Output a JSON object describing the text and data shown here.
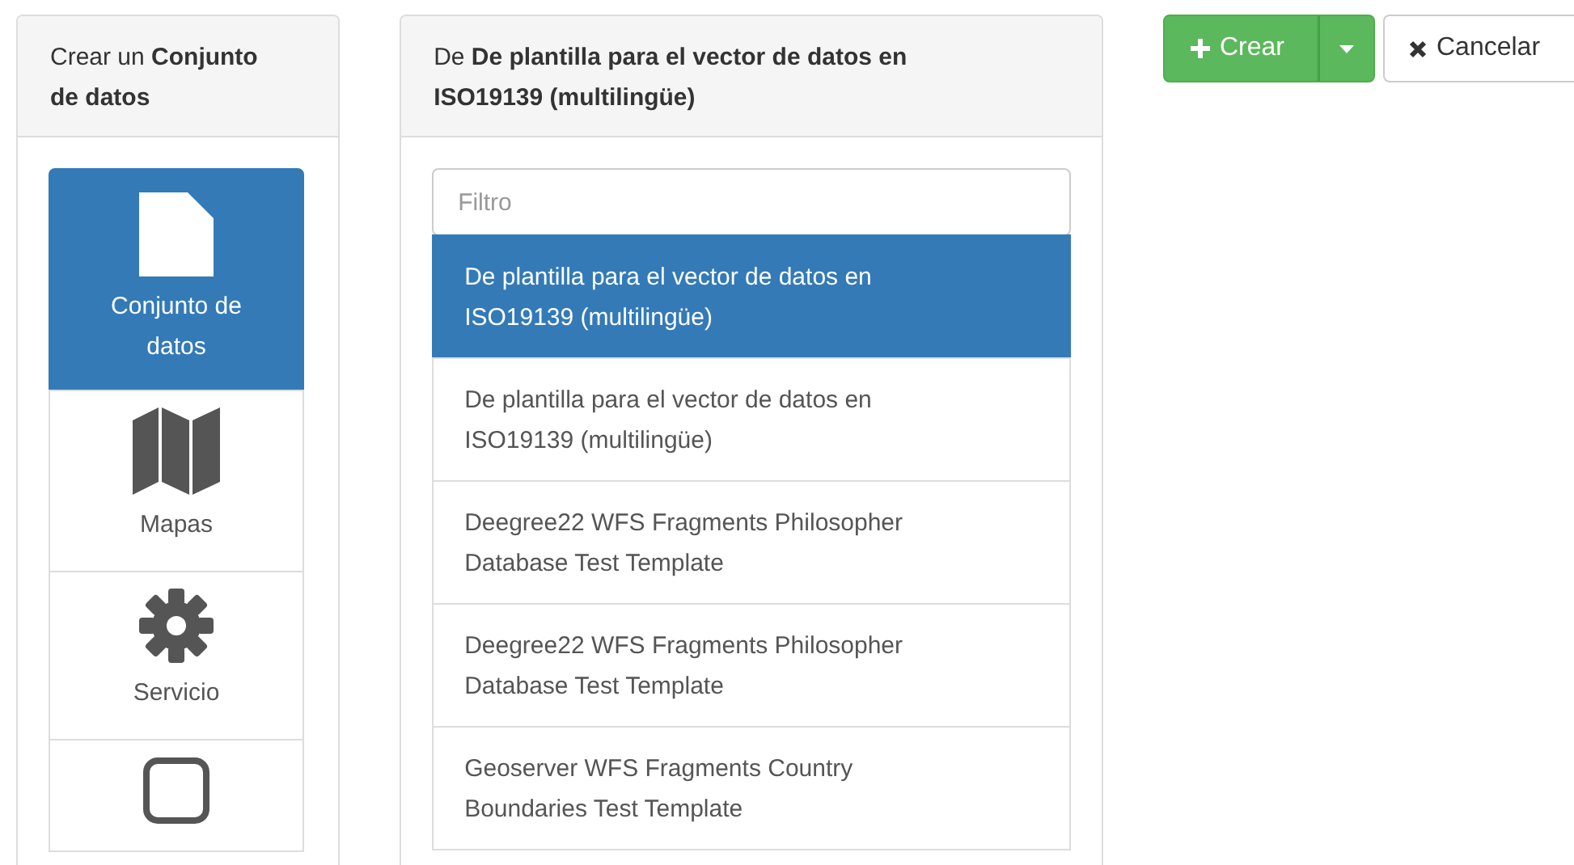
{
  "type_panel": {
    "title": "Crear un **Conjunto de datos**",
    "types": [
      {
        "kind": "file",
        "label": "Conjunto de datos",
        "selected": true
      },
      {
        "kind": "map",
        "label": "Mapas",
        "selected": false
      },
      {
        "kind": "gear",
        "label": "Servicio",
        "selected": false
      },
      {
        "kind": "square",
        "selected": false
      }
    ]
  },
  "template_panel": {
    "title": "De **De plantilla para el vector de datos en ISO19139 (multilingüe)**",
    "filter": {
      "placeholder": "Filtro"
    },
    "templates": [
      {
        "label": "De plantilla para el vector de datos en ISO19139 (multilingüe)",
        "selected": true
      },
      {
        "label": "De plantilla para el vector de datos en ISO19139 (multilingüe)",
        "selected": false
      },
      {
        "label": "Deegree22 WFS Fragments Philosopher Database Test Template",
        "selected": false
      },
      {
        "label": "Deegree22 WFS Fragments Philosopher Database Test Template",
        "selected": false
      },
      {
        "label": "Geoserver WFS Fragments Country Boundaries Test Template",
        "selected": false
      }
    ]
  },
  "actions": {
    "create": "Crear",
    "cancel": "Cancelar"
  }
}
